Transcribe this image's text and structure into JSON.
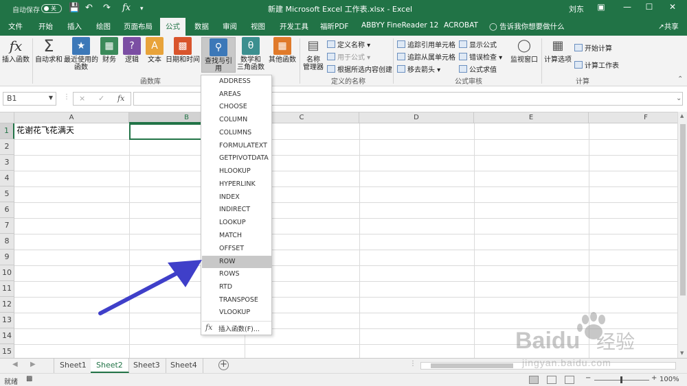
{
  "titlebar": {
    "autosave_label": "自动保存",
    "autosave_state": "关",
    "doc_title": "新建 Microsoft Excel 工作表.xlsx - Excel",
    "user": "刘东",
    "qat_icons": [
      "save-icon",
      "undo-icon",
      "redo-icon",
      "fx-icon",
      "customize-icon"
    ]
  },
  "tabs": [
    "文件",
    "开始",
    "插入",
    "绘图",
    "页面布局",
    "公式",
    "数据",
    "审阅",
    "视图",
    "开发工具",
    "福昕PDF",
    "ABBYY FineReader 12",
    "ACROBAT"
  ],
  "active_tab": "公式",
  "tellme": "告诉我你想要做什么",
  "share": "共享",
  "ribbon": {
    "insert_function": "插入函数",
    "autosum": "自动求和",
    "recent_1": "最近使用的",
    "recent_2": "函数",
    "financial": "财务",
    "logical": "逻辑",
    "text": "文本",
    "datetime": "日期和时间",
    "lookup": "查找与引用",
    "math_1": "数学和",
    "math_2": "三角函数",
    "more": "其他函数",
    "group_library": "函数库",
    "name_manager_1": "名称",
    "name_manager_2": "管理器",
    "define_name": "定义名称",
    "use_in_formula": "用于公式",
    "create_from_selection": "根据所选内容创建",
    "group_names": "定义的名称",
    "trace_precedents": "追踪引用单元格",
    "trace_dependents": "追踪从属单元格",
    "remove_arrows": "移去箭头",
    "show_formulas": "显示公式",
    "error_checking": "错误检查",
    "evaluate_formula": "公式求值",
    "watch_window": "监视窗口",
    "group_auditing": "公式审核",
    "calc_options": "计算选项",
    "calc_now": "开始计算",
    "calc_sheet": "计算工作表",
    "group_calc": "计算",
    "colors": {
      "accent": "#217346",
      "financial": "#3b8a5a",
      "logical": "#7b4ea3",
      "text": "#e8a33a",
      "datetime": "#d9552c",
      "lookup": "#3c78b8",
      "math": "#3c8f8f",
      "more": "#e07a2a",
      "autosum": "#444444"
    }
  },
  "formula_bar": {
    "name_box": "B1",
    "cancel_icon": "×",
    "enter_icon": "✓",
    "fx_label": "fx",
    "content": ""
  },
  "grid": {
    "columns": [
      "A",
      "B",
      "C",
      "D",
      "E",
      "F"
    ],
    "selected_column": "B",
    "rows": [
      "1",
      "2",
      "3",
      "4",
      "5",
      "6",
      "7",
      "8",
      "9",
      "10",
      "11",
      "12",
      "13",
      "14",
      "15"
    ],
    "selected_row": "1",
    "a1_value": "花谢花飞花满天",
    "selected_cell": "B1"
  },
  "dropdown": {
    "items": [
      "ADDRESS",
      "AREAS",
      "CHOOSE",
      "COLUMN",
      "COLUMNS",
      "FORMULATEXT",
      "GETPIVOTDATA",
      "HLOOKUP",
      "HYPERLINK",
      "INDEX",
      "INDIRECT",
      "LOOKUP",
      "MATCH",
      "OFFSET",
      "ROW",
      "ROWS",
      "RTD",
      "TRANSPOSE",
      "VLOOKUP"
    ],
    "highlighted": "ROW",
    "insert_function": "插入函数(F)..."
  },
  "sheets": [
    "Sheet1",
    "Sheet2",
    "Sheet3",
    "Sheet4"
  ],
  "active_sheet": "Sheet2",
  "status": {
    "ready": "就绪",
    "zoom": "100%"
  },
  "watermark": {
    "brand": "Baidu经验",
    "url": "jingyan.baidu.com"
  }
}
